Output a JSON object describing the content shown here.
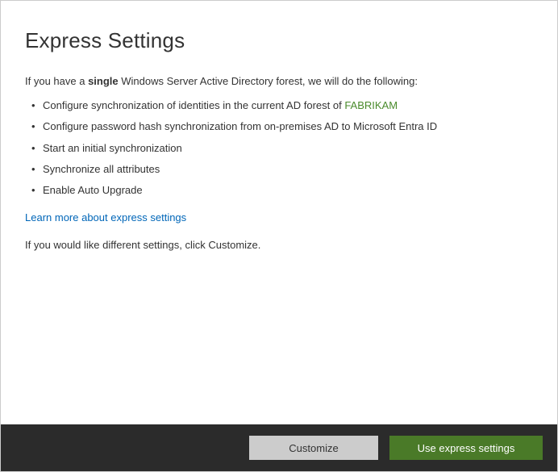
{
  "title": "Express Settings",
  "intro_prefix": "If you have a ",
  "intro_bold": "single",
  "intro_suffix": " Windows Server Active Directory forest, we will do the following:",
  "bullets": {
    "item0_prefix": "Configure synchronization of identities in the current AD forest of ",
    "item0_forest": "FABRIKAM",
    "item1": "Configure password hash synchronization from on-premises AD to Microsoft Entra ID",
    "item2": "Start an initial synchronization",
    "item3": "Synchronize all attributes",
    "item4": "Enable Auto Upgrade"
  },
  "learn_more": "Learn more about express settings",
  "outro": "If you would like different settings, click Customize.",
  "buttons": {
    "customize": "Customize",
    "use_express": "Use express settings"
  }
}
